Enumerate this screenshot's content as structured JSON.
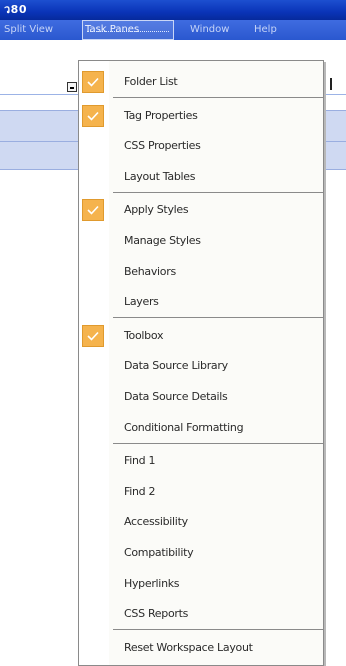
{
  "window": {
    "title": "ว80"
  },
  "menubar": {
    "items": [
      {
        "label": "Split View"
      },
      {
        "label": "Task Panes"
      },
      {
        "label": "Window"
      },
      {
        "label": "Help"
      }
    ]
  },
  "task_panes_menu": {
    "groups": [
      {
        "items": [
          {
            "label": "Folder List",
            "checked": true
          }
        ]
      },
      {
        "items": [
          {
            "label": "Tag Properties",
            "checked": true
          },
          {
            "label": "CSS Properties",
            "checked": false
          },
          {
            "label": "Layout Tables",
            "checked": false
          }
        ]
      },
      {
        "items": [
          {
            "label": "Apply Styles",
            "checked": true
          },
          {
            "label": "Manage Styles",
            "checked": false
          },
          {
            "label": "Behaviors",
            "checked": false
          },
          {
            "label": "Layers",
            "checked": false
          }
        ]
      },
      {
        "items": [
          {
            "label": "Toolbox",
            "checked": true
          },
          {
            "label": "Data Source Library",
            "checked": false
          },
          {
            "label": "Data Source Details",
            "checked": false
          },
          {
            "label": "Conditional Formatting",
            "checked": false
          }
        ]
      },
      {
        "items": [
          {
            "label": "Find 1",
            "checked": false
          },
          {
            "label": "Find 2",
            "checked": false
          },
          {
            "label": "Accessibility",
            "checked": false
          },
          {
            "label": "Compatibility",
            "checked": false
          },
          {
            "label": "Hyperlinks",
            "checked": false
          },
          {
            "label": "CSS Reports",
            "checked": false
          }
        ]
      },
      {
        "items": [
          {
            "label": "Reset Workspace Layout",
            "checked": false
          }
        ]
      }
    ]
  },
  "colors": {
    "titlebar": "#0a34b8",
    "menubar": "#2a58cf",
    "check_highlight": "#f5b34d",
    "panel_band": "#cfd9f2"
  },
  "icons": {
    "check": "check-icon",
    "dropdown": "dropdown-arrow-icon"
  }
}
